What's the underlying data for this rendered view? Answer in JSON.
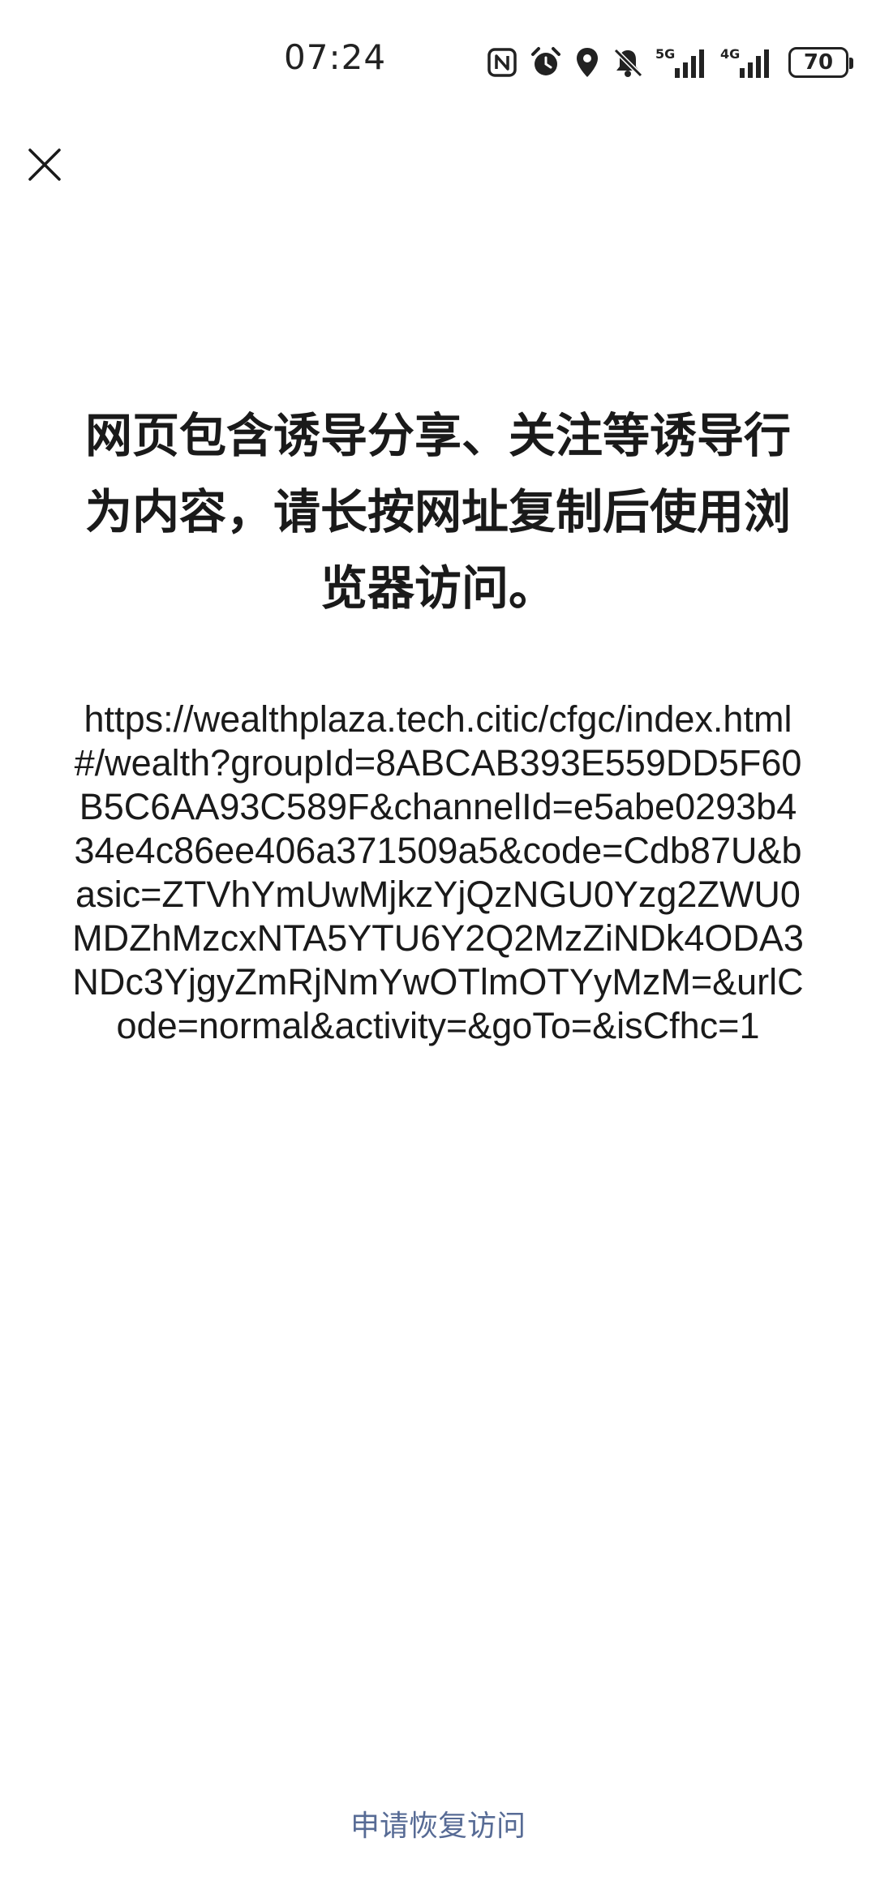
{
  "status_bar": {
    "time": "07:24",
    "icons": [
      "nfc-icon",
      "alarm-icon",
      "location-icon",
      "mute-icon",
      "signal-5g-icon",
      "signal-4g-icon"
    ],
    "network_5g": "5G",
    "network_4g": "4G",
    "battery_level": "70"
  },
  "toolbar": {
    "close_icon": "close-icon"
  },
  "warning": {
    "message": "网页包含诱导分享、关注等诱导行为内容，请长按网址复制后使用浏览器访问。"
  },
  "url": {
    "text": "https://wealthplaza.tech.citic/cfgc/index.html#/wealth?groupId=8ABCAB393E559DD5F60B5C6AA93C589F&channelId=e5abe0293b434e4c86ee406a371509a5&code=Cdb87U&basic=ZTVhYmUwMjkzYjQzNGU0Yzg2ZWU0MDZhMzcxNTA5YTU6Y2Q2MzZiNDk4ODA3NDc3YjgyZmRjNmYwOTlmOTYyMzM=&urlCode=normal&activity=&goTo=&isCfhc=1"
  },
  "footer": {
    "appeal_label": "申请恢复访问"
  },
  "colors": {
    "link": "#576b95",
    "text": "#1a1a1a",
    "background": "#ffffff"
  }
}
